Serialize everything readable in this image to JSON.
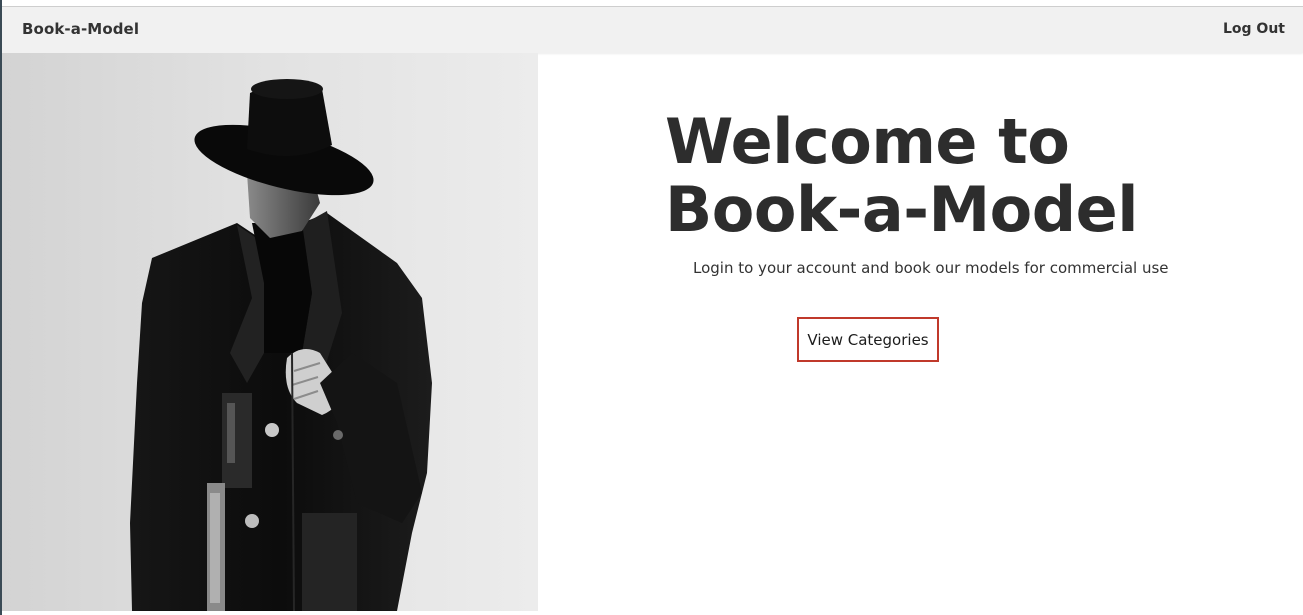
{
  "navbar": {
    "brand": "Book-a-Model",
    "logout_label": "Log Out"
  },
  "hero": {
    "title": "Welcome to Book-a-Model",
    "subtitle": "Login to your account and book our models for commercial use",
    "cta_label": "View Categories",
    "image_alt": "black and white photo of model in black hat and coat"
  },
  "colors": {
    "navbar_bg": "#f1f1f1",
    "text": "#2d2d2d",
    "cta_border": "#c0392b"
  }
}
